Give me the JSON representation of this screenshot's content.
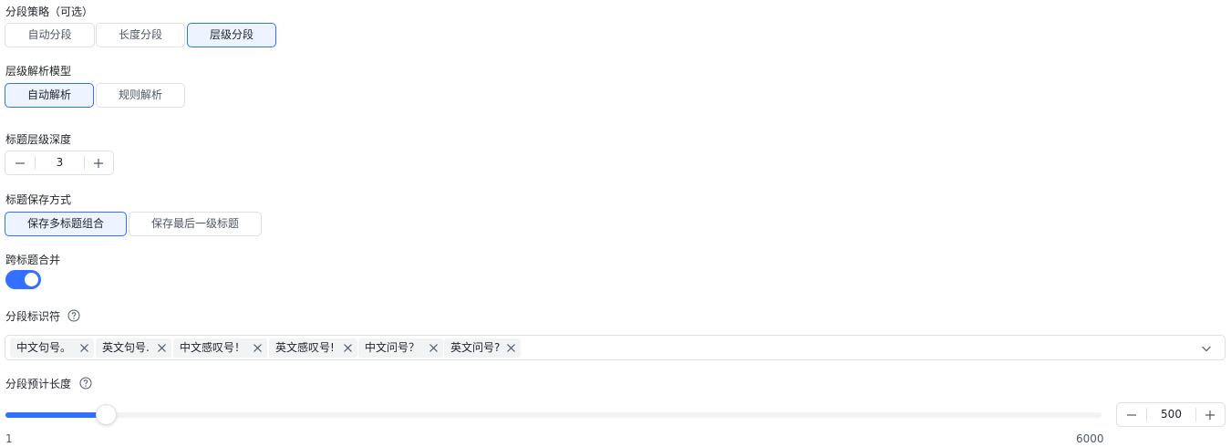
{
  "segmentation_strategy": {
    "label": "分段策略（可选）",
    "options": [
      "自动分段",
      "长度分段",
      "层级分段"
    ],
    "selected": "层级分段"
  },
  "hierarchy_model": {
    "label": "层级解析模型",
    "options": [
      "自动解析",
      "规则解析"
    ],
    "selected": "自动解析"
  },
  "heading_depth": {
    "label": "标题层级深度",
    "value": "3"
  },
  "heading_save_mode": {
    "label": "标题保存方式",
    "options": [
      "保存多标题组合",
      "保存最后一级标题"
    ],
    "selected": "保存多标题组合"
  },
  "cross_heading_merge": {
    "label": "跨标题合并",
    "enabled": true
  },
  "segment_identifiers": {
    "label": "分段标识符",
    "tags": [
      "中文句号。",
      "英文句号.",
      "中文感叹号！",
      "英文感叹号!",
      "中文问号？",
      "英文问号?"
    ]
  },
  "segment_length": {
    "label": "分段预计长度",
    "value": 500,
    "min": 1,
    "max": 6000,
    "input_value": "500"
  },
  "colors": {
    "accent": "#3370ff",
    "border": "#dee0e3",
    "active_bg": "#eef4ff"
  }
}
